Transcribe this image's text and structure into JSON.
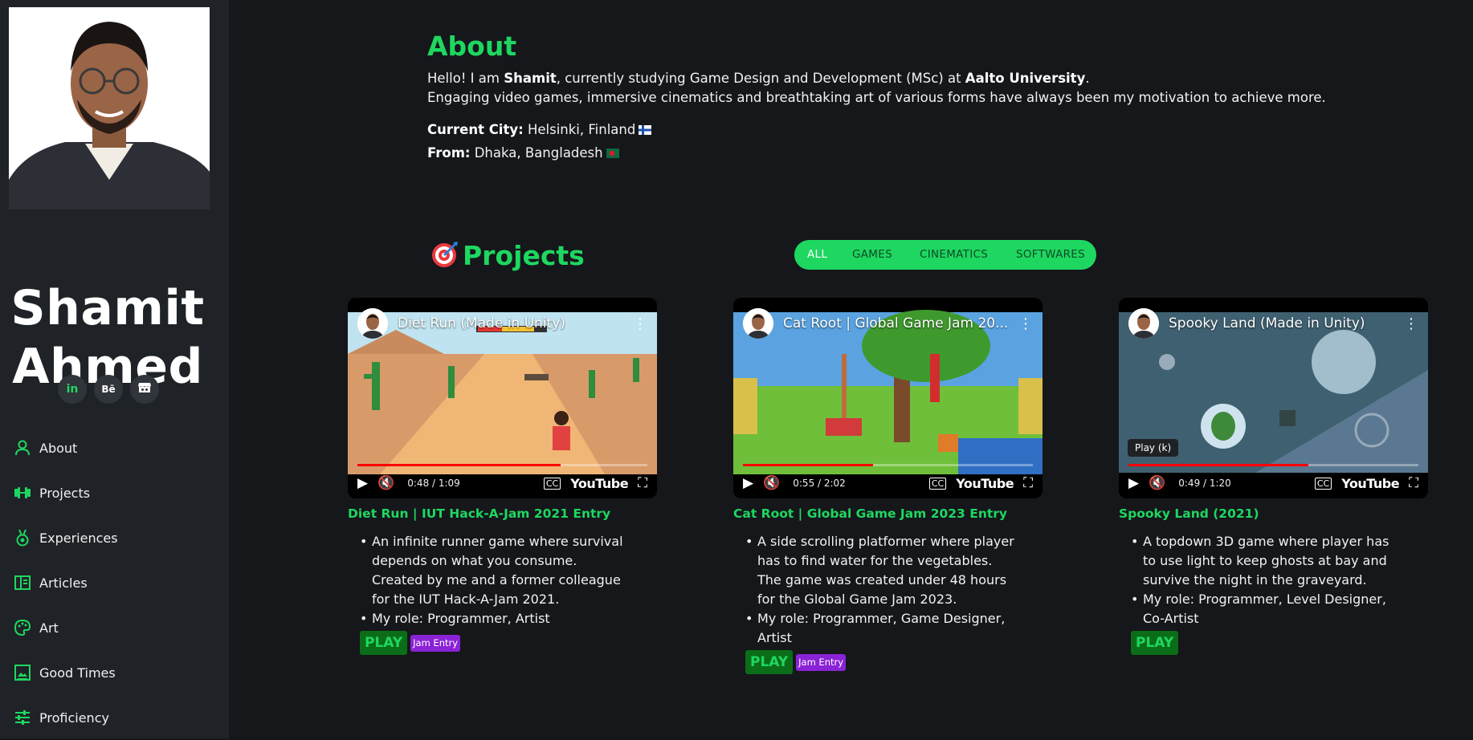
{
  "sidebar": {
    "name_line1": "Shamit",
    "name_line2": "Ahmed",
    "social": [
      {
        "label": "in",
        "icon": "linkedin-icon"
      },
      {
        "label": "Bē",
        "icon": "behance-icon"
      },
      {
        "label": "",
        "icon": "itchio-icon"
      }
    ],
    "nav": [
      {
        "label": "About",
        "icon": "user-icon"
      },
      {
        "label": "Projects",
        "icon": "dumbbell-icon"
      },
      {
        "label": "Experiences",
        "icon": "medal-icon"
      },
      {
        "label": "Articles",
        "icon": "layout-icon"
      },
      {
        "label": "Art",
        "icon": "palette-icon"
      },
      {
        "label": "Good Times",
        "icon": "image-icon"
      },
      {
        "label": "Proficiency",
        "icon": "sliders-icon"
      }
    ]
  },
  "about": {
    "title": "About",
    "intro_prefix": "Hello! I am ",
    "intro_name": "Shamit",
    "intro_middle": ", currently studying Game Design and Development (MSc) at ",
    "intro_university": "Aalto University",
    "intro_suffix": ".",
    "line2": "Engaging video games, immersive cinematics and breathtaking art of various forms have always been my motivation to achieve more.",
    "city_label": "Current City:",
    "city_value": " Helsinki, Finland",
    "from_label": "From:",
    "from_value": " Dhaka, Bangladesh"
  },
  "projects": {
    "title": "Projects",
    "filters": [
      {
        "label": "ALL",
        "active": true
      },
      {
        "label": "GAMES",
        "active": false
      },
      {
        "label": "CINEMATICS",
        "active": false
      },
      {
        "label": "SOFTWARES",
        "active": false
      }
    ],
    "cards": [
      {
        "video_title": "Diet Run (Made in Unity)",
        "time": "0:48 / 1:09",
        "progress": 0.7,
        "title": "Diet Run | IUT Hack-A-Jam 2021 Entry",
        "bullets": [
          "An infinite runner game where survival depends on what you consume. Created by me and a former colleague for the IUT Hack-A-Jam 2021.",
          "My role: Programmer, Artist"
        ],
        "play_label": "PLAY",
        "badge": "Jam Entry"
      },
      {
        "video_title": "Cat Root | Global Game Jam 20...",
        "time": "0:55 / 2:02",
        "progress": 0.45,
        "title": "Cat Root | Global Game Jam 2023 Entry",
        "bullets": [
          "A side scrolling platformer where player has to find water for the vegetables. The game was created under 48 hours for the Global Game Jam 2023.",
          "My role: Programmer, Game Designer, Artist"
        ],
        "play_label": "PLAY",
        "badge": "Jam Entry"
      },
      {
        "video_title": "Spooky Land (Made in Unity)",
        "time": "0:49 / 1:20",
        "progress": 0.62,
        "tooltip": "Play (k)",
        "title": "Spooky Land (2021)",
        "bullets": [
          "A topdown 3D game where player has to use light to keep ghosts at bay and survive the night in the graveyard.",
          "My role: Programmer, Level Designer, Co-Artist"
        ],
        "play_label": "PLAY"
      }
    ],
    "youtube_label": "YouTube"
  },
  "colors": {
    "accent": "#1ed760",
    "background": "#15171b",
    "sidebar": "#1f2327",
    "badge": "#8a22d6",
    "play_bg": "#0b6d17"
  }
}
